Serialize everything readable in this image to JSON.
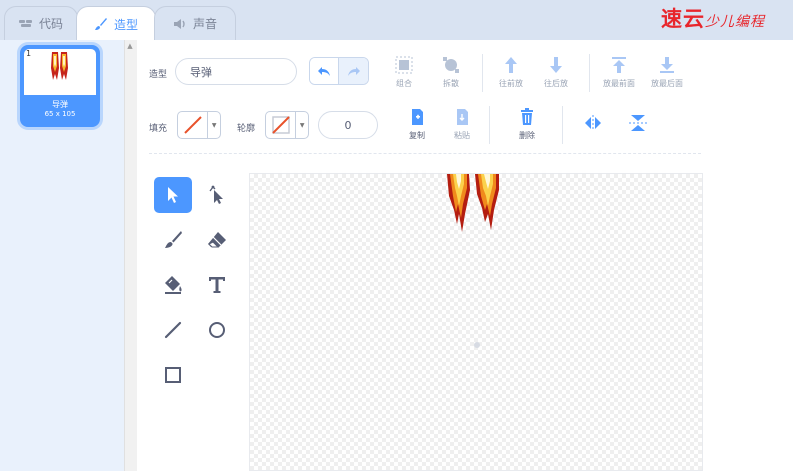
{
  "tabs": [
    {
      "label": "代码",
      "icon": "code-icon"
    },
    {
      "label": "造型",
      "icon": "brush-icon"
    },
    {
      "label": "声音",
      "icon": "speaker-icon"
    }
  ],
  "active_tab": "造型",
  "watermark": {
    "main": "速云",
    "sub": "少儿编程"
  },
  "costumes": [
    {
      "number": "1",
      "name": "导弹",
      "size": "65 x 105",
      "selected": true
    }
  ],
  "editor": {
    "costume_label": "造型",
    "costume_name": "导弹",
    "arrange_buttons": [
      "组合",
      "拆散",
      "往前放",
      "往后放",
      "放最前面",
      "放最后面"
    ],
    "fill_label": "填充",
    "outline_label": "轮廓",
    "outline_width": "0",
    "edit_buttons": [
      "复制",
      "粘贴",
      "删除"
    ],
    "palette_tools": [
      "select-tool",
      "reshape-tool",
      "brush-tool",
      "eraser-tool",
      "fill-tool",
      "text-tool",
      "line-tool",
      "circle-tool",
      "rectangle-tool"
    ],
    "selected_tool": "select-tool"
  },
  "colors": {
    "accent": "#4c97ff",
    "tab_bar": "#d9e3f2",
    "panel": "#e9f1fc",
    "tool_icon": "#575e75",
    "disabled_icon": "#9aa4b5",
    "fill_swatch_line": "#e8522b",
    "watermark": "#e8262c"
  }
}
